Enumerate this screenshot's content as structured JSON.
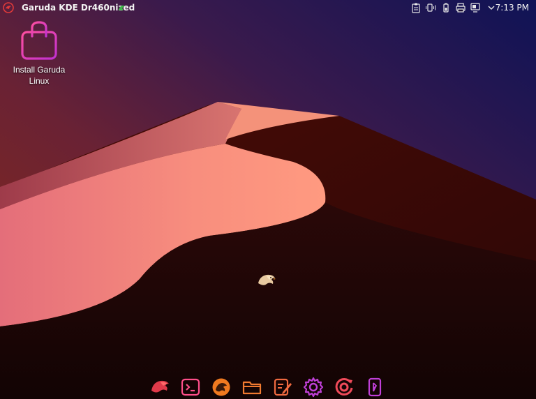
{
  "colors": {
    "sky_top": "#1a1550",
    "sky_mid": "#5a1e3a",
    "sky_low": "#8a2a1a",
    "dune_light": "#f6907c",
    "dune_shadow": "#c86a6c",
    "ground": "#1e0808",
    "accent_pink": "#e040a0",
    "accent_orange": "#f06030",
    "accent_magenta": "#c030d0"
  },
  "top_panel": {
    "app_menu_icon": "garuda-eagle-icon",
    "window_title": "Garuda KDE Dr460nized",
    "title_badge_icon": "dragon-icon",
    "tray_icons": [
      "clipboard-icon",
      "volume-icon",
      "battery-icon",
      "printer-icon",
      "network-icon",
      "chevron-down-icon"
    ],
    "clock": "7:13 PM"
  },
  "desktop_icons": [
    {
      "label": "Install Garuda Linux",
      "icon": "shopping-bag-icon"
    }
  ],
  "center_logo_icon": "garuda-eagle-logo-icon",
  "dock": {
    "items": [
      {
        "name": "garuda-launcher",
        "icon": "garuda-eagle-icon"
      },
      {
        "name": "terminal",
        "icon": "terminal-icon"
      },
      {
        "name": "firedragon-browser",
        "icon": "firedragon-icon"
      },
      {
        "name": "file-manager",
        "icon": "folder-icon"
      },
      {
        "name": "text-editor",
        "icon": "edit-icon"
      },
      {
        "name": "settings",
        "icon": "gear-icon"
      },
      {
        "name": "garuda-assistant",
        "icon": "garuda-assistant-icon"
      },
      {
        "name": "kde-connect",
        "icon": "kde-connect-icon"
      }
    ]
  }
}
